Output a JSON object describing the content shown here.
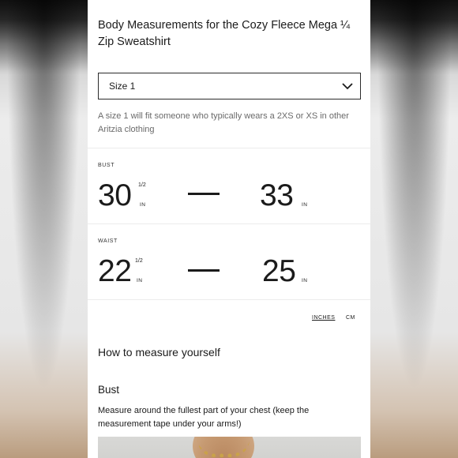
{
  "title": "Body Measurements for the Cozy Fleece Mega ¼ Zip Sweatshirt",
  "size_select": {
    "value": "Size 1",
    "icon": "chevron-down-icon"
  },
  "description": "A size 1 will fit someone who typically wears a 2XS or XS in other Aritzia clothing",
  "measurements": [
    {
      "label": "BUST",
      "min_whole": "30",
      "min_fraction": "1/2",
      "min_unit": "IN",
      "max_whole": "33",
      "max_unit": "IN"
    },
    {
      "label": "WAIST",
      "min_whole": "22",
      "min_fraction": "1/2",
      "min_unit": "IN",
      "max_whole": "25",
      "max_unit": "IN"
    }
  ],
  "units": {
    "inches": "INCHES",
    "cm": "CM",
    "selected": "inches"
  },
  "how_to": {
    "heading": "How to measure yourself",
    "section_title": "Bust",
    "section_text": "Measure around the fullest part of your chest (keep the measurement tape under your arms!)"
  },
  "colors": {
    "text": "#1b1b1b",
    "muted": "#6a6a6a",
    "divider": "#ececec",
    "panel": "#ffffff"
  }
}
